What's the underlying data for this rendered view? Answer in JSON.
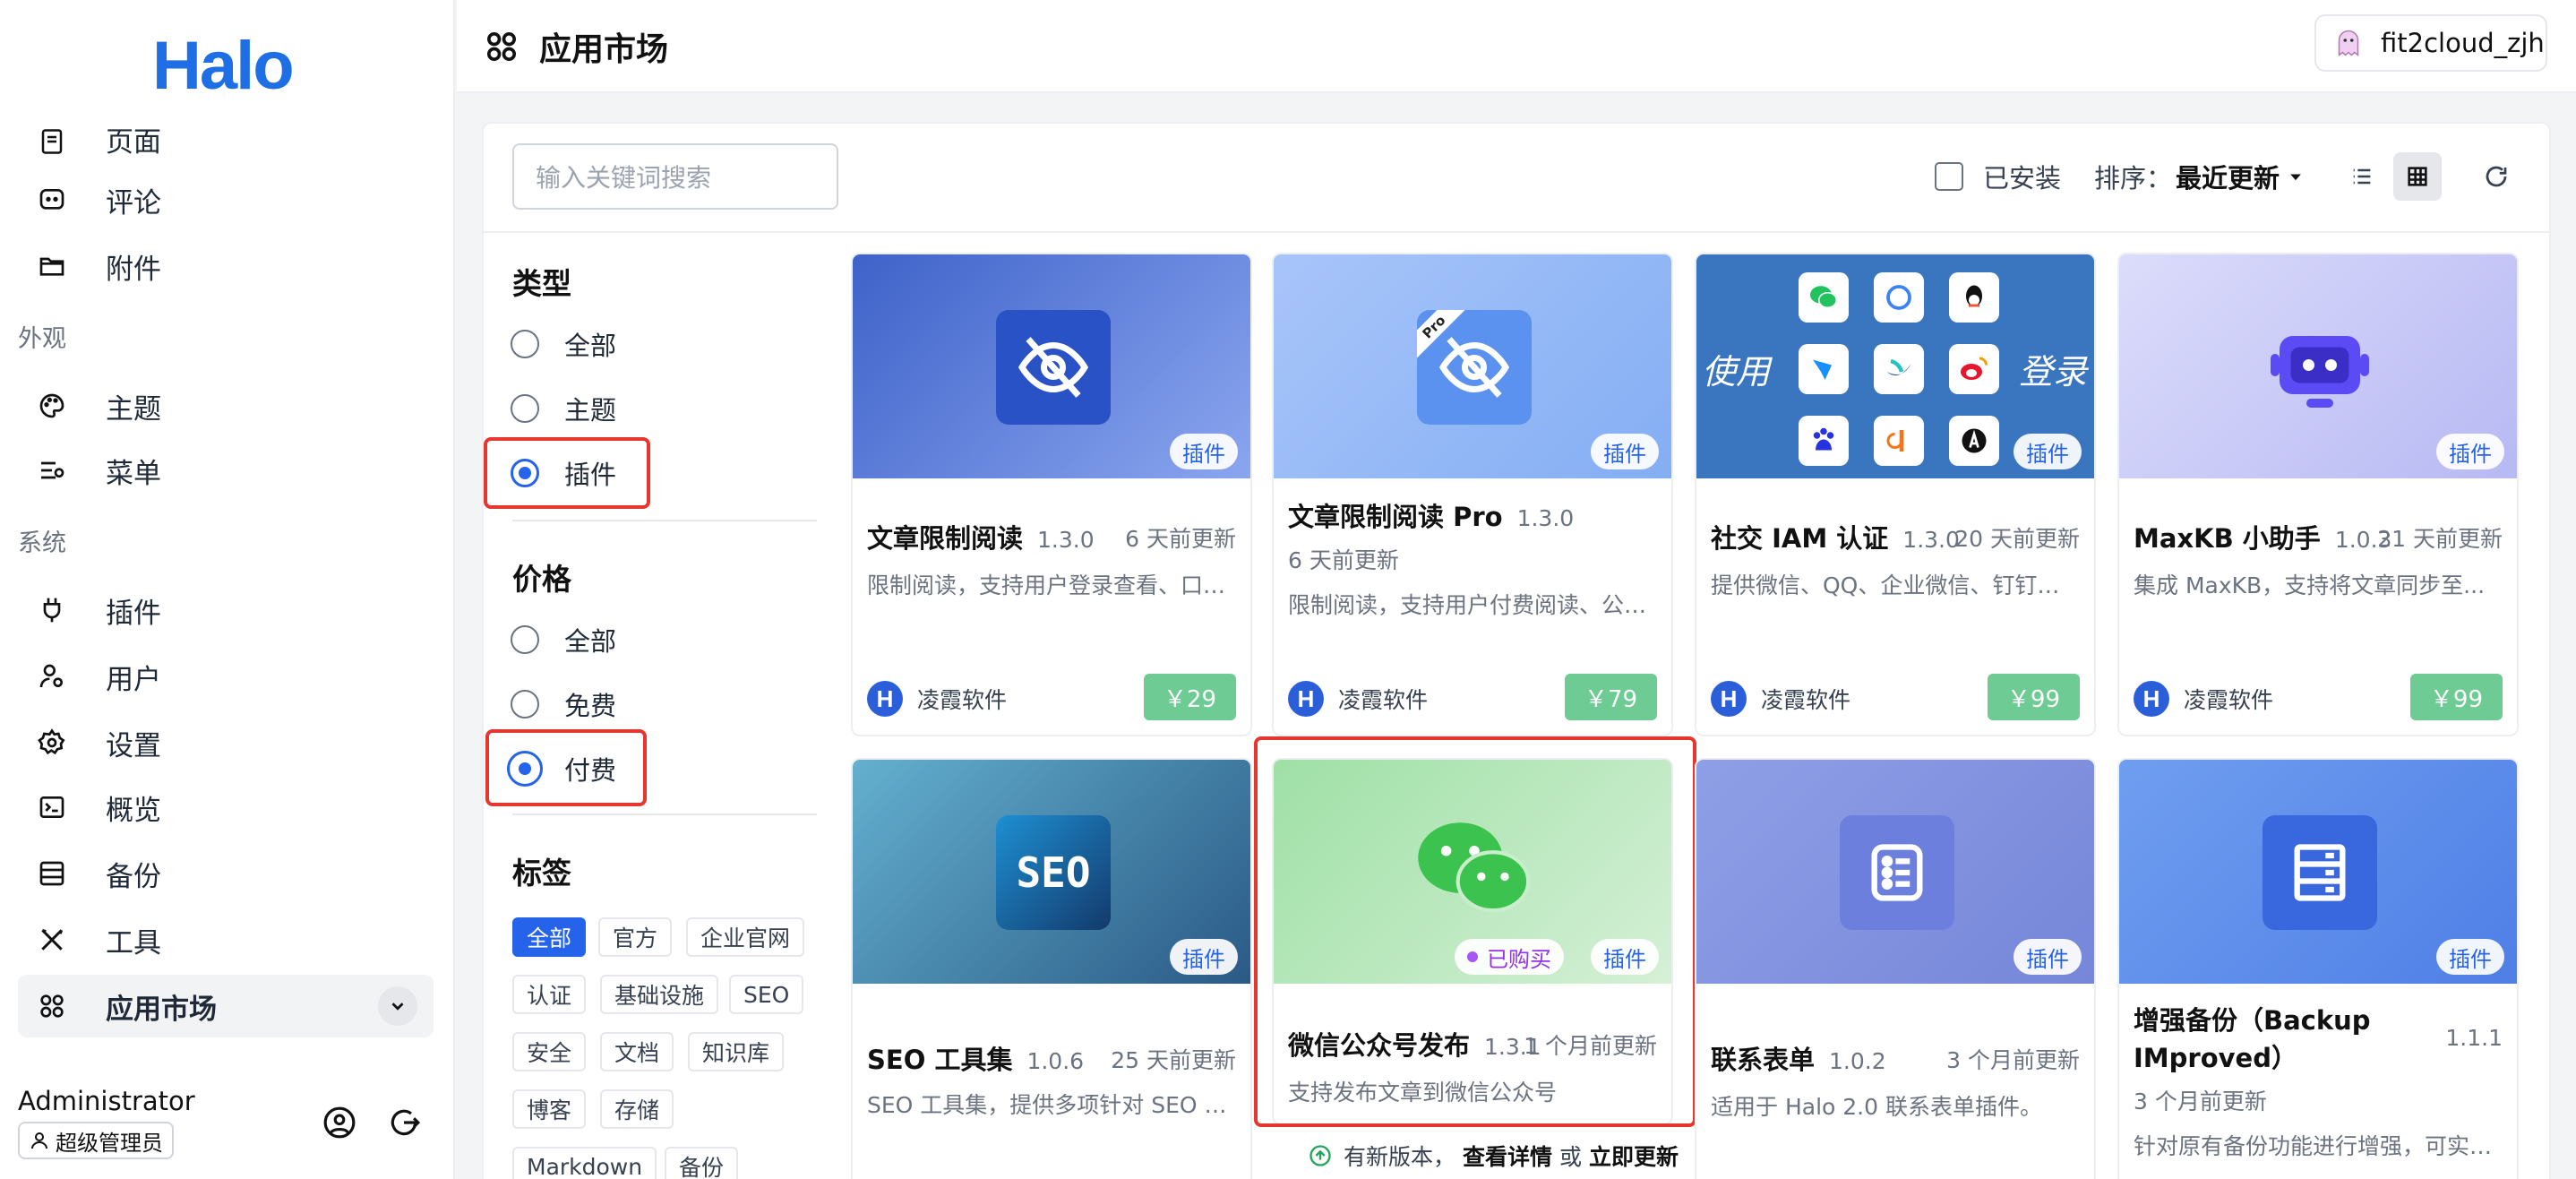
{
  "sidebar": {
    "logo": "Halo",
    "items": [
      {
        "label": "页面",
        "icon": "page-icon"
      },
      {
        "label": "评论",
        "icon": "comment-icon"
      },
      {
        "label": "附件",
        "icon": "folder-icon"
      },
      {
        "label": "主题",
        "icon": "palette-icon"
      },
      {
        "label": "菜单",
        "icon": "menu-icon"
      },
      {
        "label": "插件",
        "icon": "plug-icon"
      },
      {
        "label": "用户",
        "icon": "user-icon"
      },
      {
        "label": "设置",
        "icon": "settings-icon"
      },
      {
        "label": "概览",
        "icon": "terminal-icon"
      },
      {
        "label": "备份",
        "icon": "backup-icon"
      },
      {
        "label": "工具",
        "icon": "tools-icon"
      },
      {
        "label": "应用市场",
        "icon": "app-market-icon"
      }
    ],
    "groups": {
      "appearance": "外观",
      "system": "系统"
    },
    "user": {
      "name": "Administrator",
      "role": "超级管理员"
    }
  },
  "header": {
    "title": "应用市场",
    "account": "fit2cloud_zjh"
  },
  "toolbar": {
    "search_placeholder": "输入关键词搜索",
    "installed_label": "已安装",
    "sort_prefix": "排序：",
    "sort_value": "最近更新"
  },
  "filters": {
    "type": {
      "title": "类型",
      "options": [
        "全部",
        "主题",
        "插件"
      ],
      "selected": "插件"
    },
    "price": {
      "title": "价格",
      "options": [
        "全部",
        "免费",
        "付费"
      ],
      "selected": "付费"
    },
    "tags": {
      "title": "标签",
      "items": [
        "全部",
        "官方",
        "企业官网",
        "认证",
        "基础设施",
        "SEO",
        "安全",
        "文档",
        "知识库",
        "博客",
        "存储",
        "Markdown",
        "备份"
      ],
      "selected": "全部"
    }
  },
  "cards": [
    {
      "title": "文章限制阅读",
      "version": "1.3.0",
      "updated": "6 天前更新",
      "desc": "限制阅读，支持用户登录查看、口令...",
      "type": "插件",
      "author": "凌霞软件",
      "price": "￥29"
    },
    {
      "title": "文章限制阅读 Pro",
      "version": "1.3.0",
      "updated": "6 天前更新",
      "desc": "限制阅读，支持用户付费阅读、公众...",
      "type": "插件",
      "author": "凌霞软件",
      "price": "￥79",
      "corner": "Pro"
    },
    {
      "title": "社交 IAM 认证",
      "version": "1.3.0",
      "updated": "20 天前更新",
      "desc": "提供微信、QQ、企业微信、钉钉、...",
      "type": "插件",
      "author": "凌霞软件",
      "price": "￥99",
      "thumb_left": "使用",
      "thumb_right": "登录"
    },
    {
      "title": "MaxKB 小助手",
      "version": "1.0.3",
      "updated": "21 天前更新",
      "desc": "集成 MaxKB，支持将文章同步至...",
      "type": "插件",
      "author": "凌霞软件",
      "price": "￥99"
    },
    {
      "title": "SEO 工具集",
      "version": "1.0.6",
      "updated": "25 天前更新",
      "desc": "SEO 工具集，提供多项针对 SEO 优...",
      "type": "插件",
      "thumb_text": "SEO"
    },
    {
      "title": "微信公众号发布",
      "version": "1.3.1",
      "updated": "1 个月前更新",
      "desc": "支持发布文章到微信公众号",
      "type": "插件",
      "purchased": "已购买"
    },
    {
      "title": "联系表单",
      "version": "1.0.2",
      "updated": "3 个月前更新",
      "desc": "适用于 Halo 2.0 联系表单插件。",
      "type": "插件"
    },
    {
      "title": "增强备份（Backup IMproved）",
      "version": "1.1.1",
      "updated": "3 个月前更新",
      "desc": "针对原有备份功能进行增强，可实现...",
      "type": "插件"
    }
  ],
  "update_note": {
    "text": "有新版本，",
    "details": "查看详情",
    "or": "或",
    "update": "立即更新"
  },
  "colors": {
    "accent": "#2563eb",
    "price": "#6ecb93",
    "highlight": "#e5372d"
  }
}
